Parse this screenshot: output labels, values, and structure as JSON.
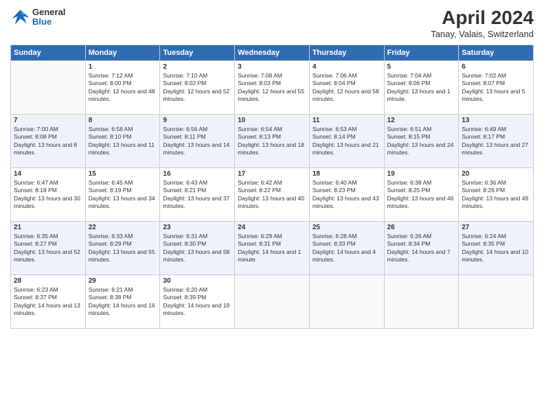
{
  "header": {
    "logo_general": "General",
    "logo_blue": "Blue",
    "month": "April 2024",
    "location": "Tanay, Valais, Switzerland"
  },
  "weekdays": [
    "Sunday",
    "Monday",
    "Tuesday",
    "Wednesday",
    "Thursday",
    "Friday",
    "Saturday"
  ],
  "weeks": [
    [
      {
        "day": "",
        "sunrise": "",
        "sunset": "",
        "daylight": ""
      },
      {
        "day": "1",
        "sunrise": "Sunrise: 7:12 AM",
        "sunset": "Sunset: 8:00 PM",
        "daylight": "Daylight: 12 hours and 48 minutes."
      },
      {
        "day": "2",
        "sunrise": "Sunrise: 7:10 AM",
        "sunset": "Sunset: 8:02 PM",
        "daylight": "Daylight: 12 hours and 52 minutes."
      },
      {
        "day": "3",
        "sunrise": "Sunrise: 7:08 AM",
        "sunset": "Sunset: 8:03 PM",
        "daylight": "Daylight: 12 hours and 55 minutes."
      },
      {
        "day": "4",
        "sunrise": "Sunrise: 7:06 AM",
        "sunset": "Sunset: 8:04 PM",
        "daylight": "Daylight: 12 hours and 58 minutes."
      },
      {
        "day": "5",
        "sunrise": "Sunrise: 7:04 AM",
        "sunset": "Sunset: 8:06 PM",
        "daylight": "Daylight: 13 hours and 1 minute."
      },
      {
        "day": "6",
        "sunrise": "Sunrise: 7:02 AM",
        "sunset": "Sunset: 8:07 PM",
        "daylight": "Daylight: 13 hours and 5 minutes."
      }
    ],
    [
      {
        "day": "7",
        "sunrise": "Sunrise: 7:00 AM",
        "sunset": "Sunset: 8:08 PM",
        "daylight": "Daylight: 13 hours and 8 minutes."
      },
      {
        "day": "8",
        "sunrise": "Sunrise: 6:58 AM",
        "sunset": "Sunset: 8:10 PM",
        "daylight": "Daylight: 13 hours and 11 minutes."
      },
      {
        "day": "9",
        "sunrise": "Sunrise: 6:56 AM",
        "sunset": "Sunset: 8:11 PM",
        "daylight": "Daylight: 13 hours and 14 minutes."
      },
      {
        "day": "10",
        "sunrise": "Sunrise: 6:54 AM",
        "sunset": "Sunset: 8:13 PM",
        "daylight": "Daylight: 13 hours and 18 minutes."
      },
      {
        "day": "11",
        "sunrise": "Sunrise: 6:53 AM",
        "sunset": "Sunset: 8:14 PM",
        "daylight": "Daylight: 13 hours and 21 minutes."
      },
      {
        "day": "12",
        "sunrise": "Sunrise: 6:51 AM",
        "sunset": "Sunset: 8:15 PM",
        "daylight": "Daylight: 13 hours and 24 minutes."
      },
      {
        "day": "13",
        "sunrise": "Sunrise: 6:49 AM",
        "sunset": "Sunset: 8:17 PM",
        "daylight": "Daylight: 13 hours and 27 minutes."
      }
    ],
    [
      {
        "day": "14",
        "sunrise": "Sunrise: 6:47 AM",
        "sunset": "Sunset: 8:18 PM",
        "daylight": "Daylight: 13 hours and 30 minutes."
      },
      {
        "day": "15",
        "sunrise": "Sunrise: 6:45 AM",
        "sunset": "Sunset: 8:19 PM",
        "daylight": "Daylight: 13 hours and 34 minutes."
      },
      {
        "day": "16",
        "sunrise": "Sunrise: 6:43 AM",
        "sunset": "Sunset: 8:21 PM",
        "daylight": "Daylight: 13 hours and 37 minutes."
      },
      {
        "day": "17",
        "sunrise": "Sunrise: 6:42 AM",
        "sunset": "Sunset: 8:22 PM",
        "daylight": "Daylight: 13 hours and 40 minutes."
      },
      {
        "day": "18",
        "sunrise": "Sunrise: 6:40 AM",
        "sunset": "Sunset: 8:23 PM",
        "daylight": "Daylight: 13 hours and 43 minutes."
      },
      {
        "day": "19",
        "sunrise": "Sunrise: 6:38 AM",
        "sunset": "Sunset: 8:25 PM",
        "daylight": "Daylight: 13 hours and 46 minutes."
      },
      {
        "day": "20",
        "sunrise": "Sunrise: 6:36 AM",
        "sunset": "Sunset: 8:26 PM",
        "daylight": "Daylight: 13 hours and 49 minutes."
      }
    ],
    [
      {
        "day": "21",
        "sunrise": "Sunrise: 6:35 AM",
        "sunset": "Sunset: 8:27 PM",
        "daylight": "Daylight: 13 hours and 52 minutes."
      },
      {
        "day": "22",
        "sunrise": "Sunrise: 6:33 AM",
        "sunset": "Sunset: 8:29 PM",
        "daylight": "Daylight: 13 hours and 55 minutes."
      },
      {
        "day": "23",
        "sunrise": "Sunrise: 6:31 AM",
        "sunset": "Sunset: 8:30 PM",
        "daylight": "Daylight: 13 hours and 58 minutes."
      },
      {
        "day": "24",
        "sunrise": "Sunrise: 6:29 AM",
        "sunset": "Sunset: 8:31 PM",
        "daylight": "Daylight: 14 hours and 1 minute."
      },
      {
        "day": "25",
        "sunrise": "Sunrise: 6:28 AM",
        "sunset": "Sunset: 8:33 PM",
        "daylight": "Daylight: 14 hours and 4 minutes."
      },
      {
        "day": "26",
        "sunrise": "Sunrise: 6:26 AM",
        "sunset": "Sunset: 8:34 PM",
        "daylight": "Daylight: 14 hours and 7 minutes."
      },
      {
        "day": "27",
        "sunrise": "Sunrise: 6:24 AM",
        "sunset": "Sunset: 8:35 PM",
        "daylight": "Daylight: 14 hours and 10 minutes."
      }
    ],
    [
      {
        "day": "28",
        "sunrise": "Sunrise: 6:23 AM",
        "sunset": "Sunset: 8:37 PM",
        "daylight": "Daylight: 14 hours and 13 minutes."
      },
      {
        "day": "29",
        "sunrise": "Sunrise: 6:21 AM",
        "sunset": "Sunset: 8:38 PM",
        "daylight": "Daylight: 14 hours and 16 minutes."
      },
      {
        "day": "30",
        "sunrise": "Sunrise: 6:20 AM",
        "sunset": "Sunset: 8:39 PM",
        "daylight": "Daylight: 14 hours and 19 minutes."
      },
      {
        "day": "",
        "sunrise": "",
        "sunset": "",
        "daylight": ""
      },
      {
        "day": "",
        "sunrise": "",
        "sunset": "",
        "daylight": ""
      },
      {
        "day": "",
        "sunrise": "",
        "sunset": "",
        "daylight": ""
      },
      {
        "day": "",
        "sunrise": "",
        "sunset": "",
        "daylight": ""
      }
    ]
  ]
}
